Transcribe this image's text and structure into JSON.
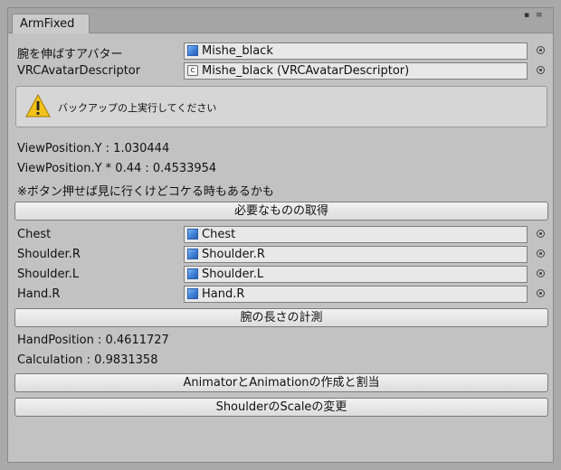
{
  "window": {
    "tab_title": "ArmFixed",
    "controls": {
      "lock_icon": "▪",
      "menu_icon": "≡"
    }
  },
  "fields_top": [
    {
      "label": "腕を伸ばすアバター",
      "value": "Mishe_black",
      "icon": "gameobject-cube-icon"
    },
    {
      "label": "VRCAvatarDescriptor",
      "value": "Mishe_black (VRCAvatarDescriptor)",
      "icon": "component-icon"
    }
  ],
  "help": {
    "icon": "warning-icon",
    "text": "バックアップの上実行してください"
  },
  "info": {
    "view_y": "ViewPosition.Y : 1.030444",
    "view_y_scaled": "ViewPosition.Y * 0.44 : 0.4533954",
    "note": "※ボタン押せば見に行くけどコケる時もあるかも"
  },
  "buttons": {
    "get_required": "必要なものの取得",
    "measure_arm": "腕の長さの計測",
    "create_animator": "AnimatorとAnimationの作成と割当",
    "change_scale": "ShoulderのScaleの変更"
  },
  "fields_bones": [
    {
      "label": "Chest",
      "value": "Chest",
      "icon": "transform-cube-icon"
    },
    {
      "label": "Shoulder.R",
      "value": "Shoulder.R",
      "icon": "transform-cube-icon"
    },
    {
      "label": "Shoulder.L",
      "value": "Shoulder.L",
      "icon": "transform-cube-icon"
    },
    {
      "label": "Hand.R",
      "value": "Hand.R",
      "icon": "transform-cube-icon"
    }
  ],
  "results": {
    "hand_position": "HandPosition : 0.4611727",
    "calculation": "Calculation : 0.9831358"
  },
  "colors": {
    "panel_bg": "#c2c2c2",
    "field_bg": "#e8e8e8",
    "warning_yellow": "#f2c21b",
    "cube_blue": "#3d7fd6"
  }
}
